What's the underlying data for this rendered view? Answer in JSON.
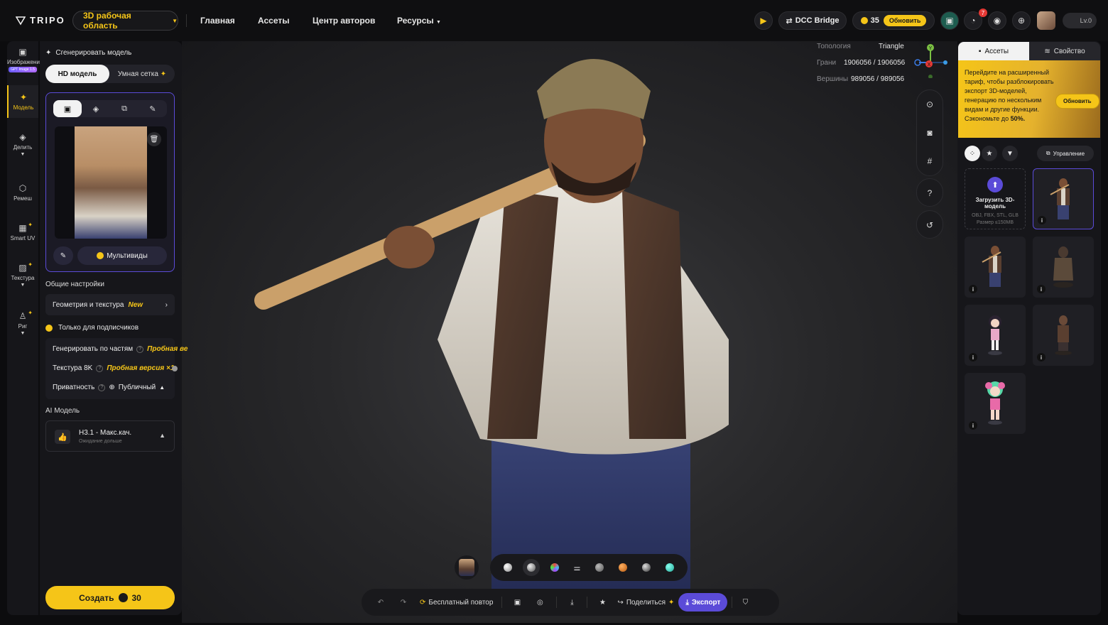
{
  "app": {
    "logo_text": "TRIPO",
    "workspace_label": "3D рабочая область"
  },
  "nav": {
    "items": [
      "Главная",
      "Ассеты",
      "Центр авторов",
      "Ресурсы"
    ]
  },
  "header": {
    "dcc_label": "DCC Bridge",
    "credits": "35",
    "upgrade_label": "Обновить",
    "notification_count": "7",
    "level": "Lv.0"
  },
  "rail": {
    "items": [
      {
        "label": "Изображени",
        "icon": "image-icon",
        "tag": "GPT Image 1.5"
      },
      {
        "label": "Модель",
        "icon": "sparkle-icon"
      },
      {
        "label": "Делить",
        "icon": "cube-split-icon"
      },
      {
        "label": "Ремеш",
        "icon": "mesh-icon"
      },
      {
        "label": "Smart UV",
        "icon": "uv-icon"
      },
      {
        "label": "Текстура",
        "icon": "texture-icon"
      },
      {
        "label": "Риг",
        "icon": "rig-icon"
      }
    ]
  },
  "left_panel": {
    "title": "Сгенерировать модель",
    "mode_hd": "HD модель",
    "mode_smart": "Умная сетка",
    "multiview_label": "Мультивиды",
    "general_settings": "Общие настройки",
    "geometry_texture": "Геометрия и текстура",
    "new_tag": "New",
    "subscribers_only": "Только для подписчиков",
    "gen_by_parts": "Генерировать по частям",
    "gen_by_parts_trial": "Пробная ве",
    "texture_8k": "Текстура 8K",
    "texture_8k_trial": "Пробная версия ×1",
    "privacy": "Приватность",
    "privacy_value": "Публичный",
    "ai_model_heading": "AI Модель",
    "ai_model_name": "H3.1 - Макс.кач.",
    "ai_model_note": "Ожидание дольше",
    "create_label": "Создать",
    "create_cost": "30"
  },
  "viewport": {
    "stats": [
      {
        "label": "Топология",
        "value": "Triangle"
      },
      {
        "label": "Грани",
        "value": "1906056 / 1906056"
      },
      {
        "label": "Вершины",
        "value": "989056 / 989056"
      }
    ],
    "gizmo_labels": {
      "y": "Y",
      "x": "X"
    }
  },
  "right_panel": {
    "tab_assets": "Ассеты",
    "tab_properties": "Свойство",
    "promo_text": "Перейдите на расширенный тариф, чтобы разблокировать экспорт 3D-моделей, генерацию по нескольким видам и другие функции. Сэкономьте до",
    "promo_percent": "50%.",
    "promo_button": "Обновить",
    "manage_label": "Управление",
    "upload_title": "Загрузить 3D-модель",
    "upload_formats": "OBJ, FBX, STL, GLB",
    "upload_size": "Размер ≤150MB",
    "info_glyph": "i"
  },
  "bottom_bar": {
    "free_retry": "Бесплатный повтор",
    "share": "Поделиться",
    "export": "Экспорт"
  },
  "colors": {
    "accent": "#f5c518",
    "primary": "#5b4bd8",
    "bg": "#0c0c0e"
  }
}
